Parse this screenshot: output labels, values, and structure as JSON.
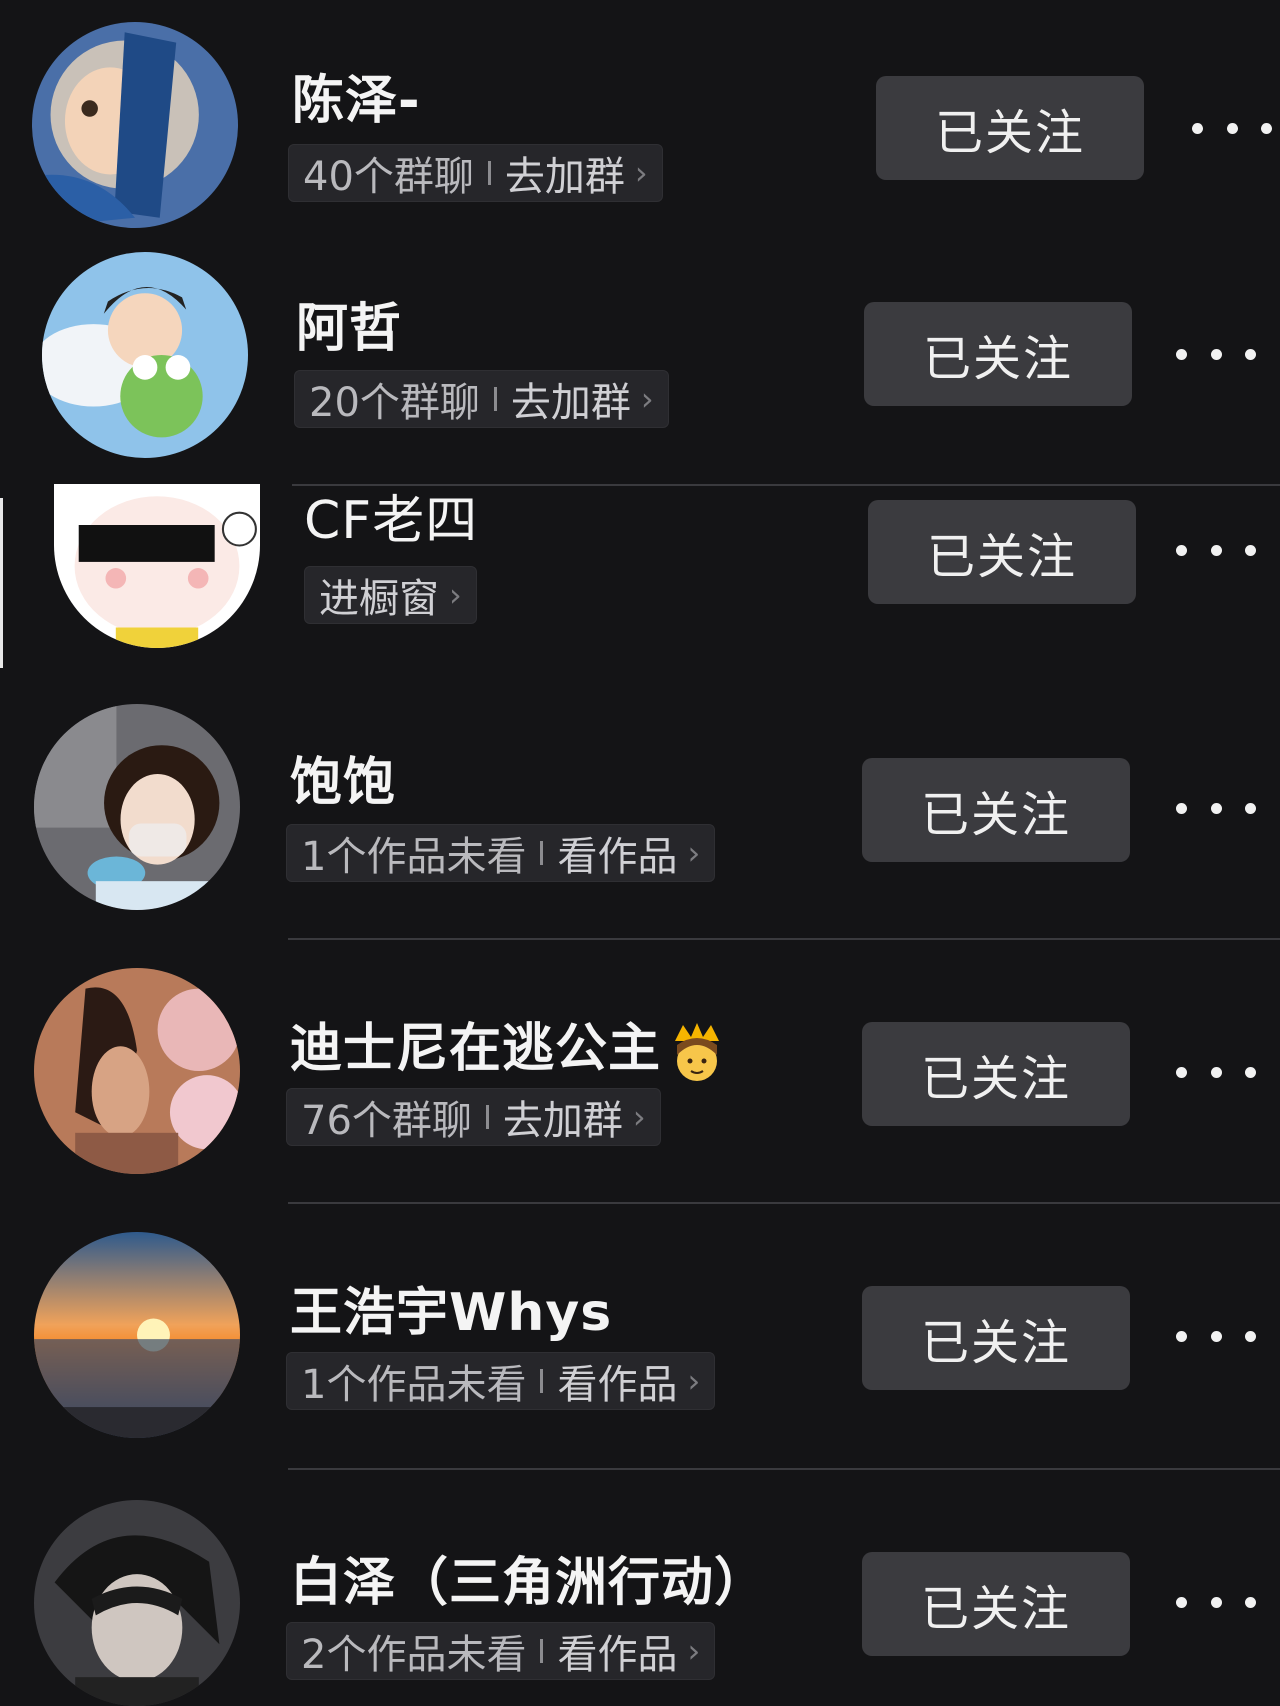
{
  "colors": {
    "background": "#141416",
    "button_bg": "#3b3b3f",
    "pill_bg": "#26262a",
    "divider": "#3a3a3e"
  },
  "follow_label": "已关注",
  "more_icon": "more-dots-icon",
  "users": [
    {
      "name": "陈泽-",
      "sub": "40个群聊",
      "action": "去加群"
    },
    {
      "name": "阿哲",
      "sub": "20个群聊",
      "action": "去加群"
    },
    {
      "name": "CF老四",
      "sub": "",
      "action": "进橱窗"
    },
    {
      "name": "饱饱",
      "sub": "1个作品未看",
      "action": "看作品"
    },
    {
      "name": "迪士尼在逃公主",
      "sub": "76个群聊",
      "action": "去加群",
      "emoji": "crown-princess-emoji"
    },
    {
      "name": "王浩宇Whys",
      "sub": "1个作品未看",
      "action": "看作品"
    },
    {
      "name": "白泽（三角洲行动）",
      "sub": "2个作品未看",
      "action": "看作品"
    }
  ]
}
